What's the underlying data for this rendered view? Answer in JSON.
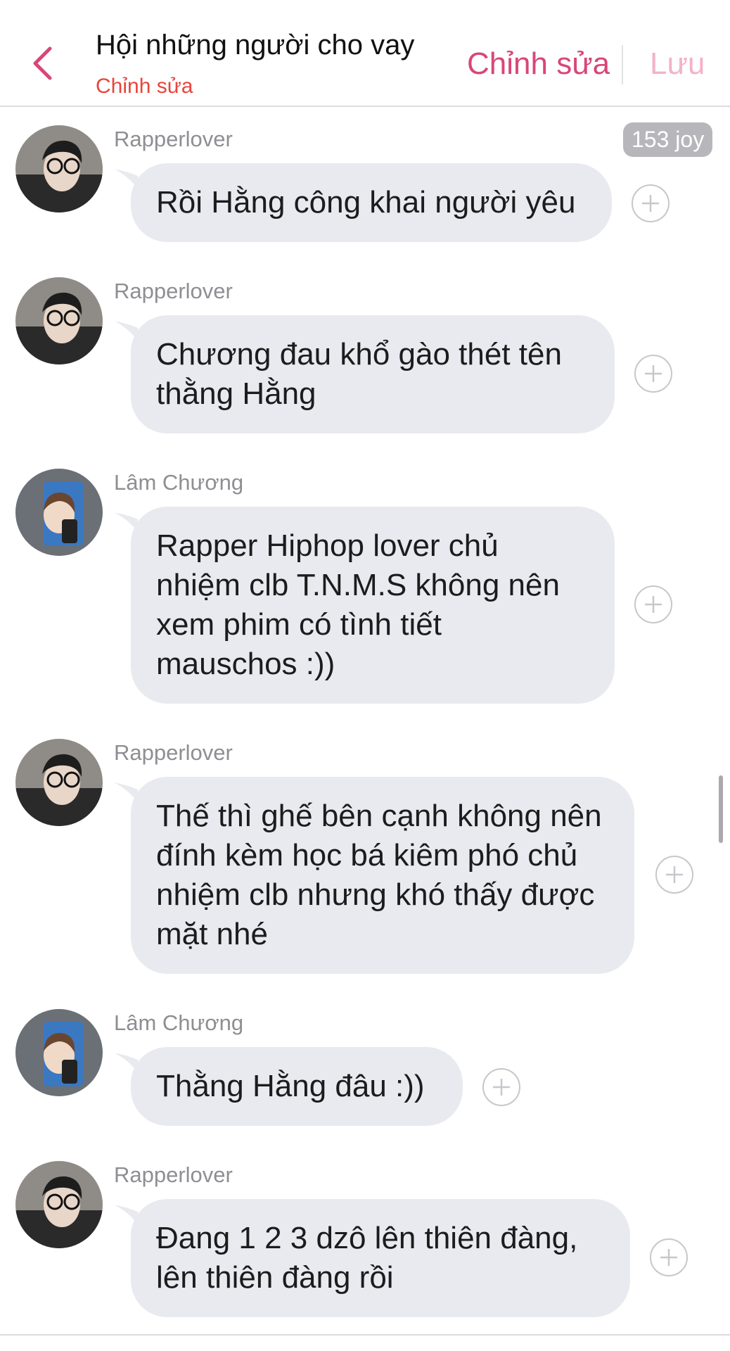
{
  "header": {
    "title": "Hội những người cho vay",
    "subtitle": "Chỉnh sửa",
    "edit_label": "Chỉnh sửa",
    "save_label": "Lưu",
    "accent_color": "#d8467a",
    "subtitle_color": "#e8453c",
    "back_icon": "chevron-left-icon"
  },
  "badge": {
    "joy_label": "153 joy"
  },
  "messages": [
    {
      "sender": "Rapperlover",
      "text": "Rồi Hằng công khai người yêu"
    },
    {
      "sender": "Rapperlover",
      "text": "Chương đau khổ gào thét tên thằng Hằng"
    },
    {
      "sender": "Lâm Chương",
      "text": "Rapper Hiphop lover chủ nhiệm clb T.N.M.S không nên xem phim có tình tiết mauschos :))"
    },
    {
      "sender": "Rapperlover",
      "text": "Thế thì ghế bên cạnh không nên đính kèm học bá kiêm phó chủ nhiệm clb nhưng khó thấy được mặt nhé"
    },
    {
      "sender": "Lâm Chương",
      "text": "Thằng Hằng đâu :))"
    },
    {
      "sender": "Rapperlover",
      "text": "Đang 1 2 3 dzô lên thiên đàng, lên thiên đàng rồi"
    }
  ],
  "colors": {
    "bubble": "#e9eaef",
    "sender_name": "#8e8e93"
  }
}
